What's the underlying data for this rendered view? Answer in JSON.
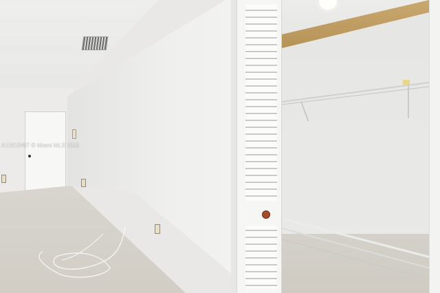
{
  "watermark": {
    "text": "A11813487 © Miami MLS 2025"
  },
  "scene": {
    "description_tags": [
      "hallway",
      "closet",
      "louvered-door",
      "wire-shelf",
      "tile-floor"
    ]
  },
  "colors": {
    "wall": "#efefed",
    "floor": "#d2cec6",
    "shelf_wood": "#b18c4e",
    "door_pull": "#a44e2a"
  }
}
